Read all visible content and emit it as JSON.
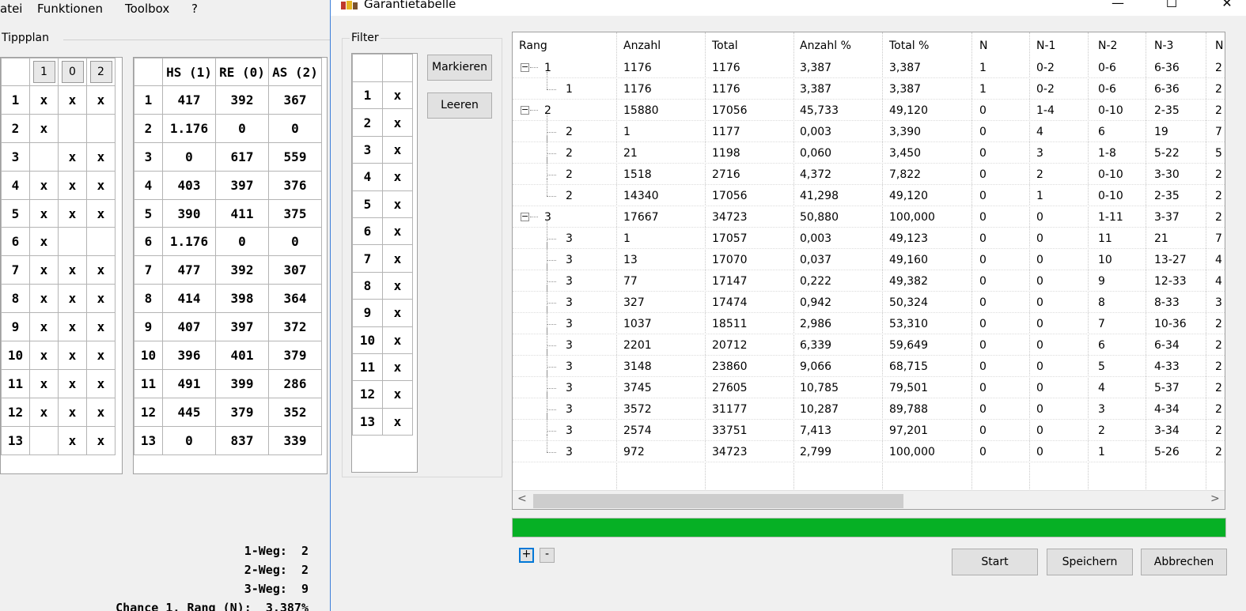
{
  "main": {
    "menu": [
      "atei",
      "Funktionen",
      "Toolbox",
      "?"
    ],
    "tippplan_label": "Tippplan",
    "tipp_header": [
      "1",
      "0",
      "2"
    ],
    "tipp_rows": [
      [
        "1",
        "x",
        "x",
        "x"
      ],
      [
        "2",
        "x",
        "",
        ""
      ],
      [
        "3",
        "",
        "x",
        "x"
      ],
      [
        "4",
        "x",
        "x",
        "x"
      ],
      [
        "5",
        "x",
        "x",
        "x"
      ],
      [
        "6",
        "x",
        "",
        ""
      ],
      [
        "7",
        "x",
        "x",
        "x"
      ],
      [
        "8",
        "x",
        "x",
        "x"
      ],
      [
        "9",
        "x",
        "x",
        "x"
      ],
      [
        "10",
        "x",
        "x",
        "x"
      ],
      [
        "11",
        "x",
        "x",
        "x"
      ],
      [
        "12",
        "x",
        "x",
        "x"
      ],
      [
        "13",
        "",
        "x",
        "x"
      ]
    ],
    "stat_header": [
      "HS (1)",
      "RE (0)",
      "AS (2)"
    ],
    "stat_rows": [
      [
        "1",
        "417",
        "392",
        "367"
      ],
      [
        "2",
        "1.176",
        "0",
        "0"
      ],
      [
        "3",
        "0",
        "617",
        "559"
      ],
      [
        "4",
        "403",
        "397",
        "376"
      ],
      [
        "5",
        "390",
        "411",
        "375"
      ],
      [
        "6",
        "1.176",
        "0",
        "0"
      ],
      [
        "7",
        "477",
        "392",
        "307"
      ],
      [
        "8",
        "414",
        "398",
        "364"
      ],
      [
        "9",
        "407",
        "397",
        "372"
      ],
      [
        "10",
        "396",
        "401",
        "379"
      ],
      [
        "11",
        "491",
        "399",
        "286"
      ],
      [
        "12",
        "445",
        "379",
        "352"
      ],
      [
        "13",
        "0",
        "837",
        "339"
      ]
    ],
    "stats": [
      {
        "label": "1-Weg:",
        "value": "2"
      },
      {
        "label": "2-Weg:",
        "value": "2"
      },
      {
        "label": "3-Weg:",
        "value": "9"
      },
      {
        "label": "Chance 1. Rang (N):",
        "value": "3,387%"
      }
    ]
  },
  "dialog": {
    "title": "Garantietabelle",
    "window_controls": {
      "minimize": "—",
      "maximize": "☐",
      "close": "✕"
    },
    "filter_label": "Filter",
    "filter_rows": [
      [
        "1",
        "x"
      ],
      [
        "2",
        "x"
      ],
      [
        "3",
        "x"
      ],
      [
        "4",
        "x"
      ],
      [
        "5",
        "x"
      ],
      [
        "6",
        "x"
      ],
      [
        "7",
        "x"
      ],
      [
        "8",
        "x"
      ],
      [
        "9",
        "x"
      ],
      [
        "10",
        "x"
      ],
      [
        "11",
        "x"
      ],
      [
        "12",
        "x"
      ],
      [
        "13",
        "x"
      ]
    ],
    "mark_button": "Markieren",
    "clear_button": "Leeren",
    "columns": [
      "Rang",
      "Anzahl",
      "Total",
      "Anzahl %",
      "Total %",
      "N",
      "N-1",
      "N-2",
      "N-3",
      "N"
    ],
    "rows": [
      {
        "level": 0,
        "expand": "−",
        "values": [
          "1",
          "1176",
          "1176",
          "3,387",
          "3,387",
          "1",
          "0-2",
          "0-6",
          "6-36",
          "2"
        ]
      },
      {
        "level": 1,
        "last": true,
        "values": [
          "1",
          "1176",
          "1176",
          "3,387",
          "3,387",
          "1",
          "0-2",
          "0-6",
          "6-36",
          "2"
        ]
      },
      {
        "level": 0,
        "expand": "−",
        "values": [
          "2",
          "15880",
          "17056",
          "45,733",
          "49,120",
          "0",
          "1-4",
          "0-10",
          "2-35",
          "2"
        ]
      },
      {
        "level": 1,
        "values": [
          "2",
          "1",
          "1177",
          "0,003",
          "3,390",
          "0",
          "4",
          "6",
          "19",
          "7"
        ]
      },
      {
        "level": 1,
        "values": [
          "2",
          "21",
          "1198",
          "0,060",
          "3,450",
          "0",
          "3",
          "1-8",
          "5-22",
          "5"
        ]
      },
      {
        "level": 1,
        "values": [
          "2",
          "1518",
          "2716",
          "4,372",
          "7,822",
          "0",
          "2",
          "0-10",
          "3-30",
          "2"
        ]
      },
      {
        "level": 1,
        "last": true,
        "values": [
          "2",
          "14340",
          "17056",
          "41,298",
          "49,120",
          "0",
          "1",
          "0-10",
          "2-35",
          "2"
        ]
      },
      {
        "level": 0,
        "expand": "−",
        "values": [
          "3",
          "17667",
          "34723",
          "50,880",
          "100,000",
          "0",
          "0",
          "1-11",
          "3-37",
          "2"
        ]
      },
      {
        "level": 1,
        "values": [
          "3",
          "1",
          "17057",
          "0,003",
          "49,123",
          "0",
          "0",
          "11",
          "21",
          "7"
        ]
      },
      {
        "level": 1,
        "values": [
          "3",
          "13",
          "17070",
          "0,037",
          "49,160",
          "0",
          "0",
          "10",
          "13-27",
          "4"
        ]
      },
      {
        "level": 1,
        "values": [
          "3",
          "77",
          "17147",
          "0,222",
          "49,382",
          "0",
          "0",
          "9",
          "12-33",
          "4"
        ]
      },
      {
        "level": 1,
        "values": [
          "3",
          "327",
          "17474",
          "0,942",
          "50,324",
          "0",
          "0",
          "8",
          "8-33",
          "3"
        ]
      },
      {
        "level": 1,
        "values": [
          "3",
          "1037",
          "18511",
          "2,986",
          "53,310",
          "0",
          "0",
          "7",
          "10-36",
          "2"
        ]
      },
      {
        "level": 1,
        "values": [
          "3",
          "2201",
          "20712",
          "6,339",
          "59,649",
          "0",
          "0",
          "6",
          "6-34",
          "2"
        ]
      },
      {
        "level": 1,
        "values": [
          "3",
          "3148",
          "23860",
          "9,066",
          "68,715",
          "0",
          "0",
          "5",
          "4-33",
          "2"
        ]
      },
      {
        "level": 1,
        "values": [
          "3",
          "3745",
          "27605",
          "10,785",
          "79,501",
          "0",
          "0",
          "4",
          "5-37",
          "2"
        ]
      },
      {
        "level": 1,
        "values": [
          "3",
          "3572",
          "31177",
          "10,287",
          "89,788",
          "0",
          "0",
          "3",
          "4-34",
          "2"
        ]
      },
      {
        "level": 1,
        "values": [
          "3",
          "2574",
          "33751",
          "7,413",
          "97,201",
          "0",
          "0",
          "2",
          "3-34",
          "2"
        ]
      },
      {
        "level": 1,
        "last": true,
        "values": [
          "3",
          "972",
          "34723",
          "2,799",
          "100,000",
          "0",
          "0",
          "1",
          "5-26",
          "2"
        ]
      }
    ],
    "scroll_left": "<",
    "scroll_right": ">",
    "progress_fraction": 1.0,
    "expand_all": "+",
    "collapse_all": "-",
    "start_button": "Start",
    "save_button": "Speichern",
    "cancel_button": "Abbrechen",
    "colors": {
      "progress": "#06b025",
      "focus": "#0078d7"
    }
  }
}
